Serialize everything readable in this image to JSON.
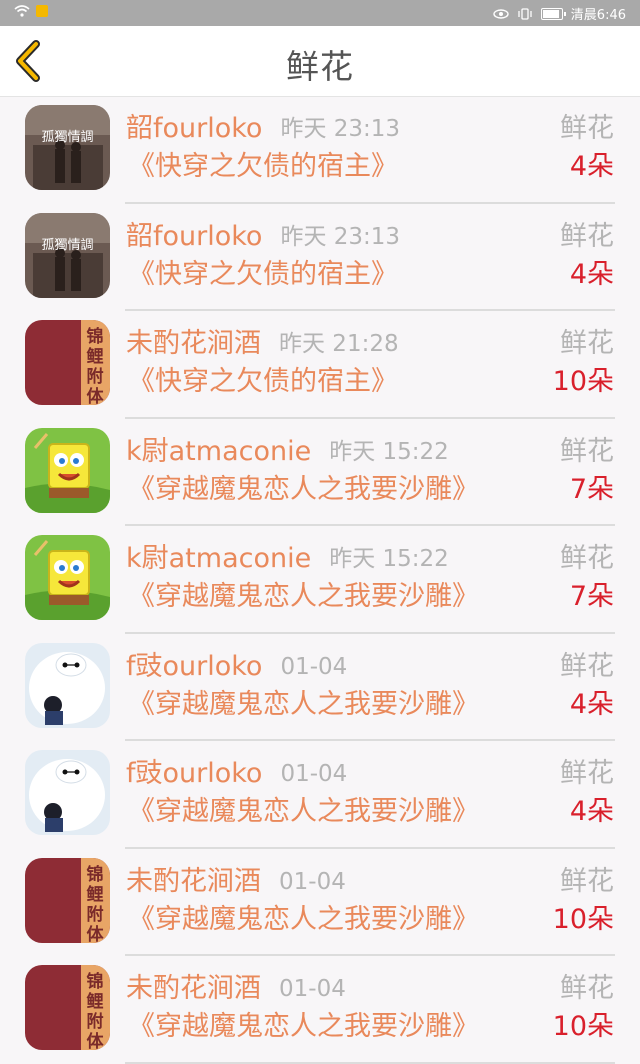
{
  "status_bar": {
    "time": "清晨6:46"
  },
  "header": {
    "title": "鲜花"
  },
  "colors": {
    "accent": "#e9895b",
    "count": "#d9202c",
    "muted": "#b4b4b4"
  },
  "rows": [
    {
      "avatar": "film-poster-avatar",
      "avatar_text": "孤獨情調",
      "name": "韶fourloko",
      "time": "昨天 23:13",
      "gift": "鲜花",
      "book": "《快穿之欠债的宿主》",
      "count": "4朵"
    },
    {
      "avatar": "film-poster-avatar",
      "avatar_text": "孤獨情調",
      "name": "韶fourloko",
      "time": "昨天 23:13",
      "gift": "鲜花",
      "book": "《快穿之欠债的宿主》",
      "count": "4朵"
    },
    {
      "avatar": "book-cover-avatar",
      "avatar_text": "锦鲤附体",
      "name": "未酌花涧酒",
      "time": "昨天 21:28",
      "gift": "鲜花",
      "book": "《快穿之欠债的宿主》",
      "count": "10朵"
    },
    {
      "avatar": "spongebob-avatar",
      "avatar_text": "",
      "name": "k尉atmaconie",
      "time": "昨天 15:22",
      "gift": "鲜花",
      "book": "《穿越魔鬼恋人之我要沙雕》",
      "count": "7朵"
    },
    {
      "avatar": "spongebob-avatar",
      "avatar_text": "",
      "name": "k尉atmaconie",
      "time": "昨天 15:22",
      "gift": "鲜花",
      "book": "《穿越魔鬼恋人之我要沙雕》",
      "count": "7朵"
    },
    {
      "avatar": "baymax-avatar",
      "avatar_text": "",
      "name": "f豉ourloko",
      "time": "01-04",
      "gift": "鲜花",
      "book": "《穿越魔鬼恋人之我要沙雕》",
      "count": "4朵"
    },
    {
      "avatar": "baymax-avatar",
      "avatar_text": "",
      "name": "f豉ourloko",
      "time": "01-04",
      "gift": "鲜花",
      "book": "《穿越魔鬼恋人之我要沙雕》",
      "count": "4朵"
    },
    {
      "avatar": "book-cover-avatar",
      "avatar_text": "锦鲤附体",
      "name": "未酌花涧酒",
      "time": "01-04",
      "gift": "鲜花",
      "book": "《穿越魔鬼恋人之我要沙雕》",
      "count": "10朵"
    },
    {
      "avatar": "book-cover-avatar",
      "avatar_text": "锦鲤附体",
      "name": "未酌花涧酒",
      "time": "01-04",
      "gift": "鲜花",
      "book": "《穿越魔鬼恋人之我要沙雕》",
      "count": "10朵"
    }
  ]
}
